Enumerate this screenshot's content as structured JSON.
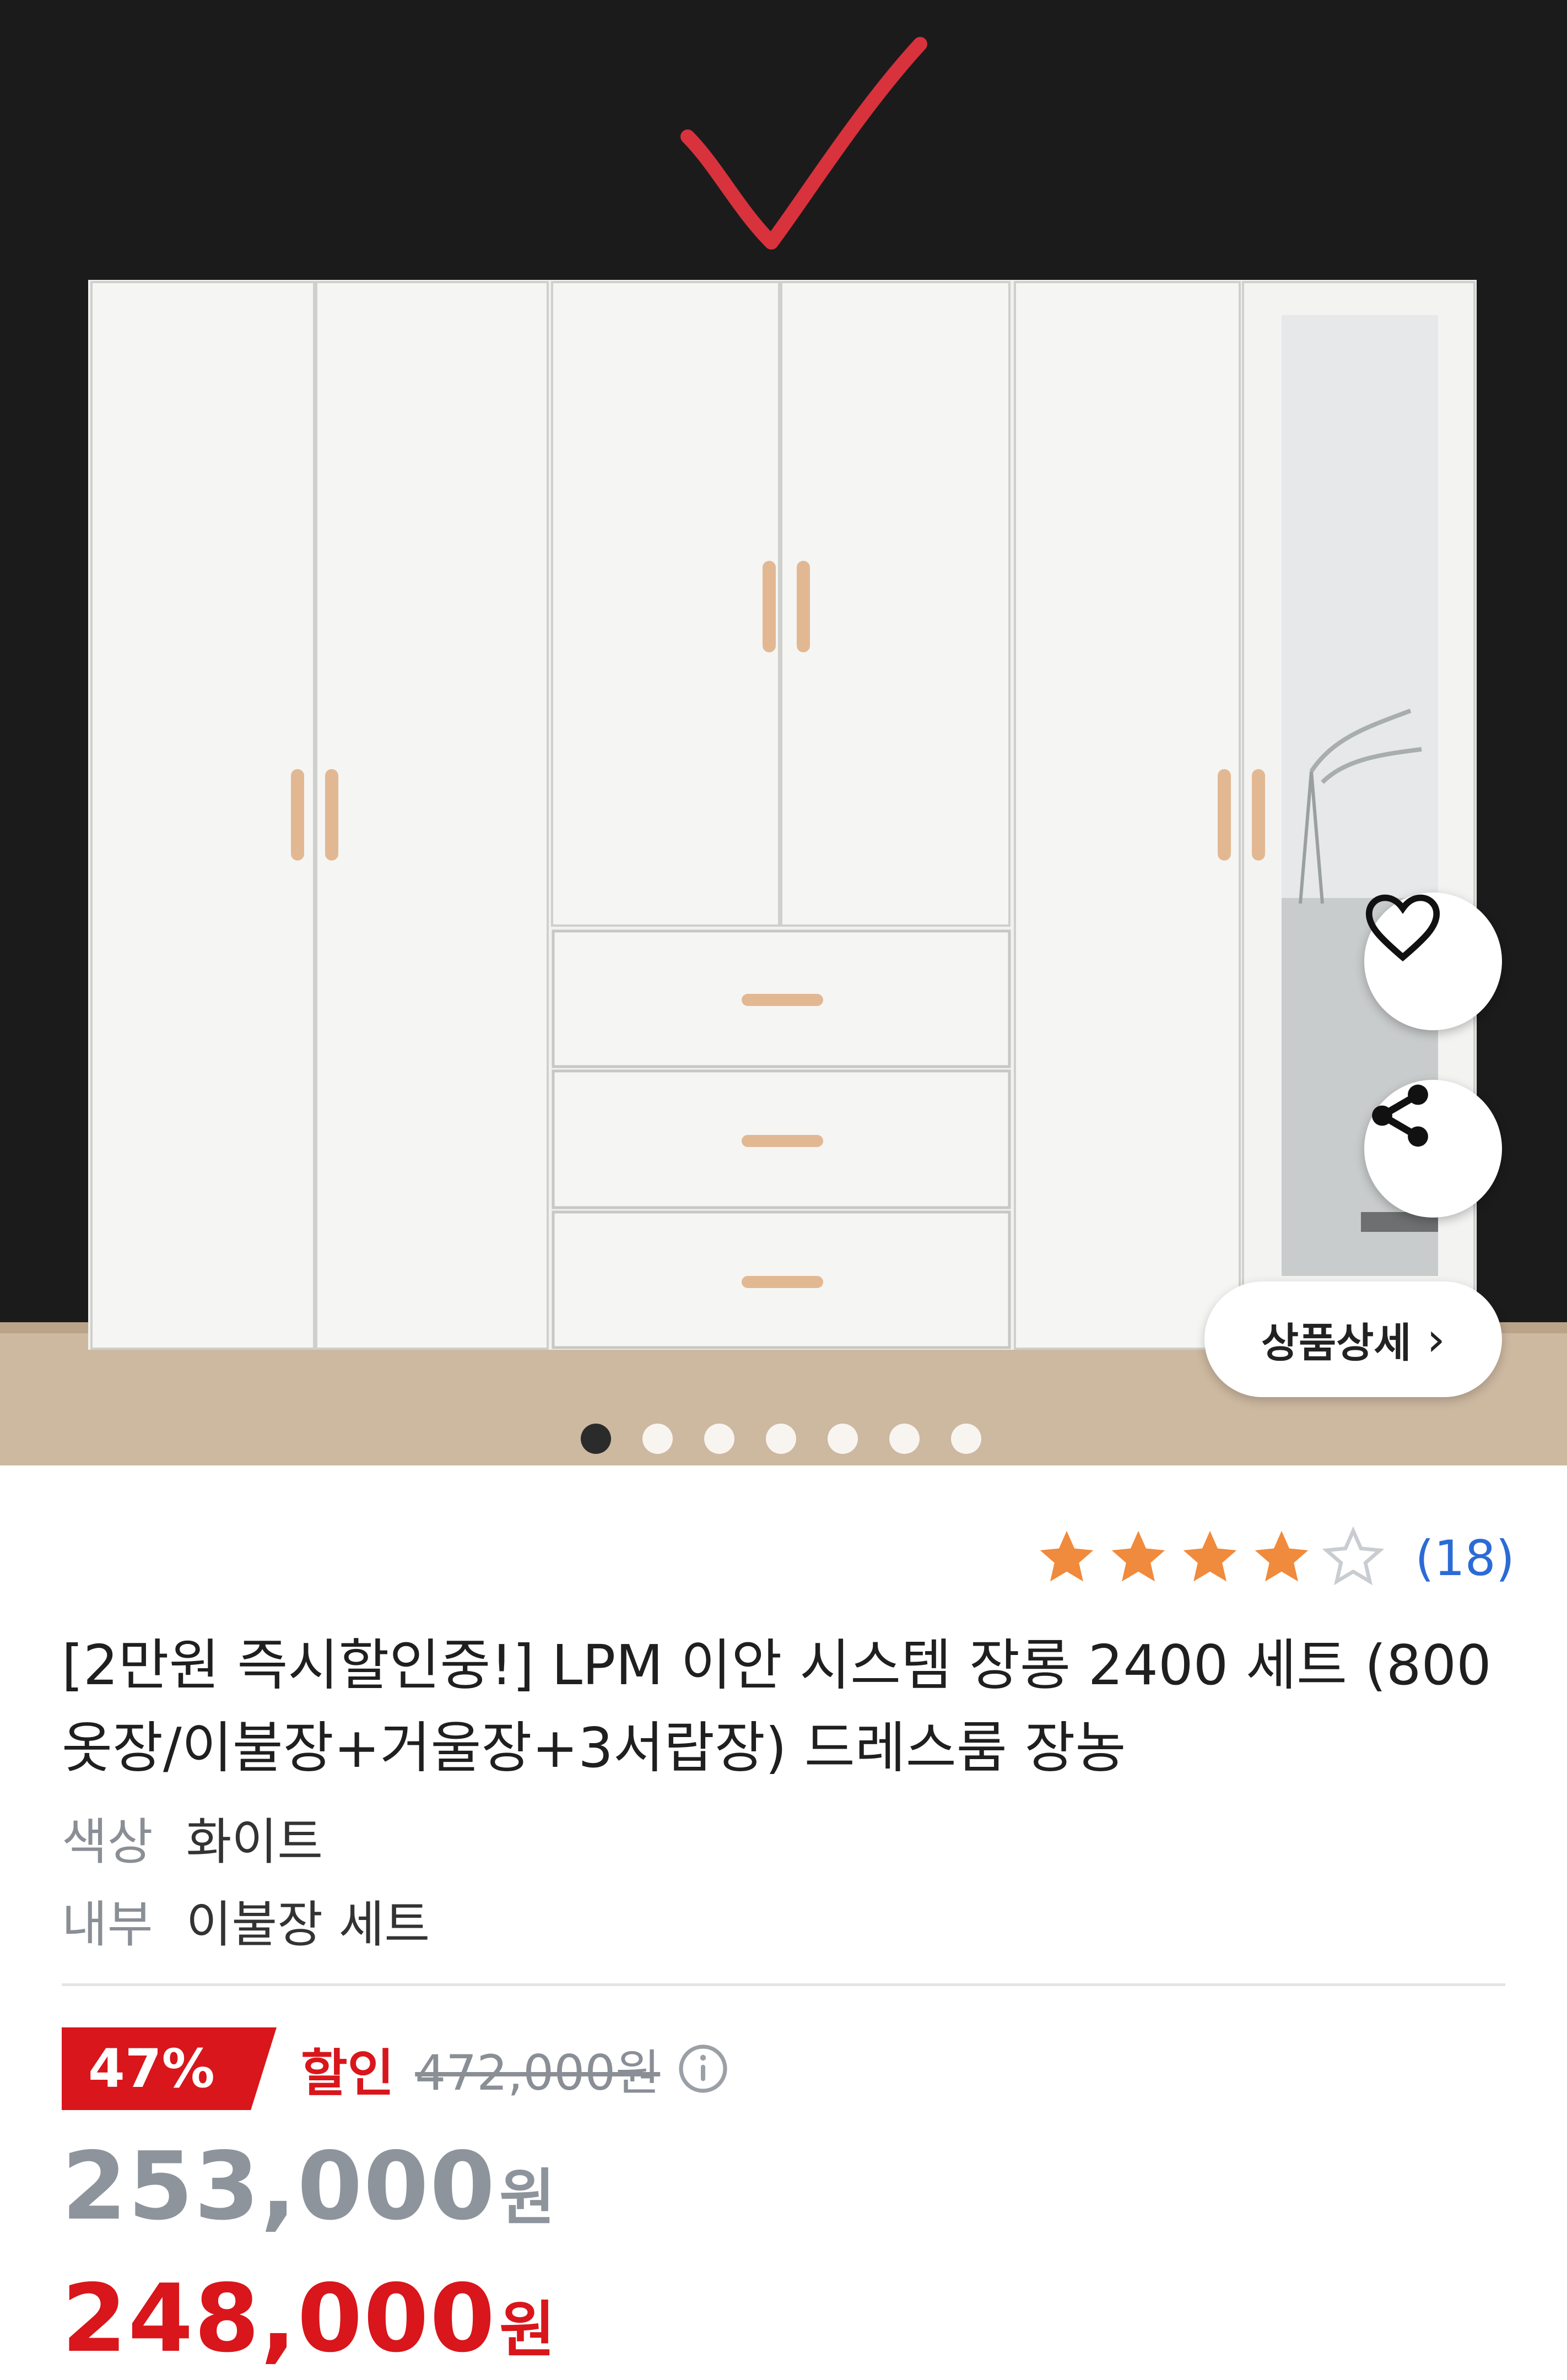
{
  "product_image": {
    "carousel": {
      "total": 7,
      "active_index": 0
    }
  },
  "actions": {
    "wish_icon": "heart-icon",
    "share_icon": "share-icon",
    "detail_label": "상품상세",
    "detail_chevron": "›"
  },
  "rating": {
    "stars_filled": 4,
    "stars_total": 5,
    "review_count": "(18)"
  },
  "product": {
    "title": "[2만원 즉시할인중!] LPM 이안 시스템 장롱 2400 세트 (800옷장/이불장+거울장+3서랍장) 드레스룸 장농"
  },
  "options": [
    {
      "label": "색상",
      "value": "화이트"
    },
    {
      "label": "내부",
      "value": "이불장 세트"
    }
  ],
  "pricing": {
    "discount_rate": "47%",
    "discount_word": "할인",
    "original_price": "472,000원",
    "price": "253,000",
    "price_currency": "원",
    "final_price": "248,000",
    "final_currency": "원"
  },
  "colors": {
    "accent_red": "#d8161b",
    "link_blue": "#2b6bd6",
    "star_orange": "#f08a3c"
  }
}
